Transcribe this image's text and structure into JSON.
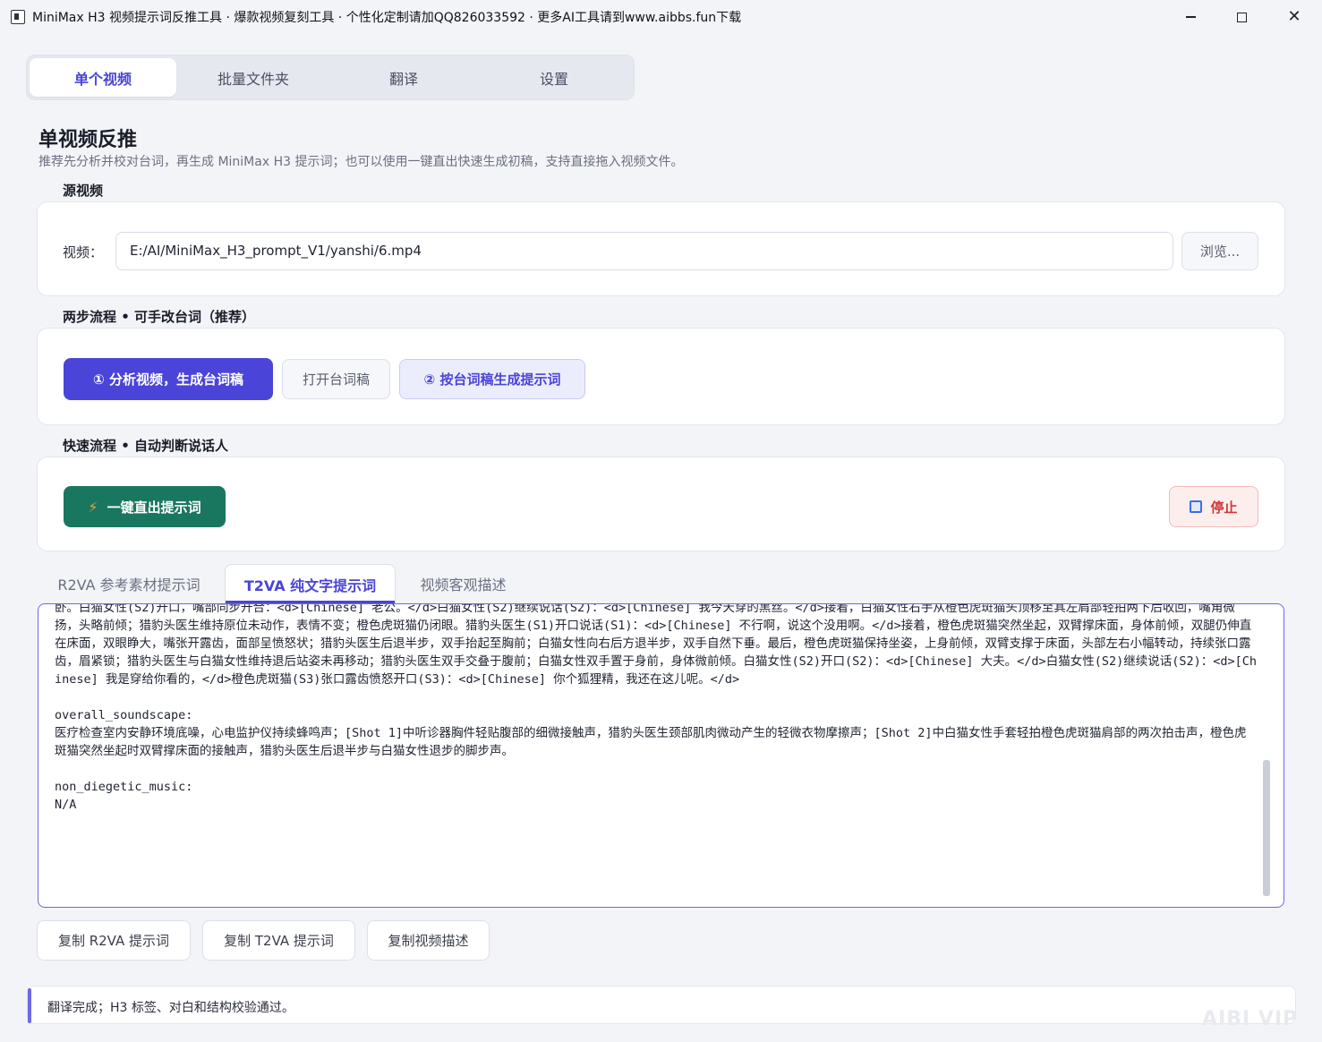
{
  "window": {
    "title": "MiniMax H3 视频提示词反推工具 · 爆款视频复刻工具 · 个性化定制请加QQ826033592 · 更多AI工具请到www.aibbs.fun下载",
    "minimize_icon": "minimize-icon",
    "maximize_icon": "maximize-icon",
    "close_icon": "close-icon"
  },
  "nav": {
    "tabs": [
      {
        "label": "单个视频",
        "active": true
      },
      {
        "label": "批量文件夹",
        "active": false
      },
      {
        "label": "翻译",
        "active": false
      },
      {
        "label": "设置",
        "active": false
      }
    ]
  },
  "page": {
    "title": "单视频反推",
    "subtitle": "推荐先分析并校对台词，再生成 MiniMax H3 提示词；也可以使用一键直出快速生成初稿，支持直接拖入视频文件。"
  },
  "source": {
    "group_label": "源视频",
    "field_label": "视频：",
    "path_value": "E:/AI/MiniMax_H3_prompt_V1/yanshi/6.mp4",
    "browse_label": "浏览..."
  },
  "two_step": {
    "group_label": "两步流程 • 可手改台词（推荐）",
    "analyze_label": "① 分析视频，生成台词稿",
    "open_label": "打开台词稿",
    "generate_label": "② 按台词稿生成提示词"
  },
  "quick": {
    "group_label": "快速流程 • 自动判断说话人",
    "run_label": "一键直出提示词",
    "stop_label": "停止",
    "accent_color": "#19775f"
  },
  "result_tabs": [
    {
      "label": "R2VA 参考素材提示词",
      "active": false
    },
    {
      "label": "T2VA 纯文字提示词",
      "active": true
    },
    {
      "label": "视频客观描述",
      "active": false
    }
  ],
  "result_text": "侧白猫女性弯腰靠近橙色虎斑猫；无影灯居画面上方中央，背景为浅蓝墙面、心电监护仪与白色储物柜；橙色虎斑猫腹部裸露占画面下中部显著区域，白猫女性金发垂落至肩部清晰可见。开场时，橙色虎斑猫仰卧于蓝色检查床，穿红色运动短裤（左腿外侧有白色数字\"3\"刺绣），双眼闭合；猎豹头医生穿白大褂、黑领带，戴听诊器与白手套，立于床左侧；白猫女性穿灰色高领连衣裙、黑丝袜、黑高跟鞋，戴白手套，立于床右侧，身体前倾，右手轻触橙色虎斑猫头部；三者均完整可见。随后，白猫女性右手轻触橙色虎斑猫头顶持续停留，面部微张口，眼神专注；猎豹头医生左手持听诊器悬停于橙色虎斑猫腹部上方未接触，目光注视橙色虎斑猫；橙色虎斑猫保持闭眼仰卧。白猫女性(S2)开口，嘴部同步开合：<d>[Chinese] 老公。</d>白猫女性(S2)继续说话(S2)：<d>[Chinese] 我今天穿的黑丝。</d>接着，白猫女性右手从橙色虎斑猫头顶移至其左肩部轻拍两下后收回，嘴角微扬，头略前倾；猎豹头医生维持原位未动作，表情不变；橙色虎斑猫仍闭眼。猎豹头医生(S1)开口说话(S1)：<d>[Chinese] 不行啊，说这个没用啊。</d>接着，橙色虎斑猫突然坐起，双臂撑床面，身体前倾，双腿仍伸直在床面，双眼睁大，嘴张开露齿，面部呈愤怒状；猎豹头医生后退半步，双手抬起至胸前；白猫女性向右后方退半步，双手自然下垂。最后，橙色虎斑猫保持坐姿，上身前倾，双臂支撑于床面，头部左右小幅转动，持续张口露齿，眉紧锁；猎豹头医生与白猫女性维持退后站姿未再移动；猎豹头医生双手交叠于腹前；白猫女性双手置于身前，身体微前倾。白猫女性(S2)开口(S2)：<d>[Chinese] 大夫。</d>白猫女性(S2)继续说话(S2)：<d>[Chinese] 我是穿给你看的，</d>橙色虎斑猫(S3)张口露齿愤怒开口(S3)：<d>[Chinese] 你个狐狸精，我还在这儿呢。</d>\n\noverall_soundscape:\n医疗检查室内安静环境底噪，心电监护仪持续蜂鸣声；[Shot 1]中听诊器胸件轻贴腹部的细微接触声，猎豹头医生颈部肌肉微动产生的轻微衣物摩擦声；[Shot 2]中白猫女性手套轻拍橙色虎斑猫肩部的两次拍击声，橙色虎斑猫突然坐起时双臂撑床面的接触声，猎豹头医生后退半步与白猫女性退步的脚步声。\n\nnon_diegetic_music:\nN/A",
  "copy_buttons": {
    "r2va": "复制 R2VA 提示词",
    "t2va": "复制 T2VA 提示词",
    "desc": "复制视频描述"
  },
  "status": {
    "text": "翻译完成；H3 标签、对白和结构校验通过。"
  },
  "watermark": "AIBI VIP"
}
